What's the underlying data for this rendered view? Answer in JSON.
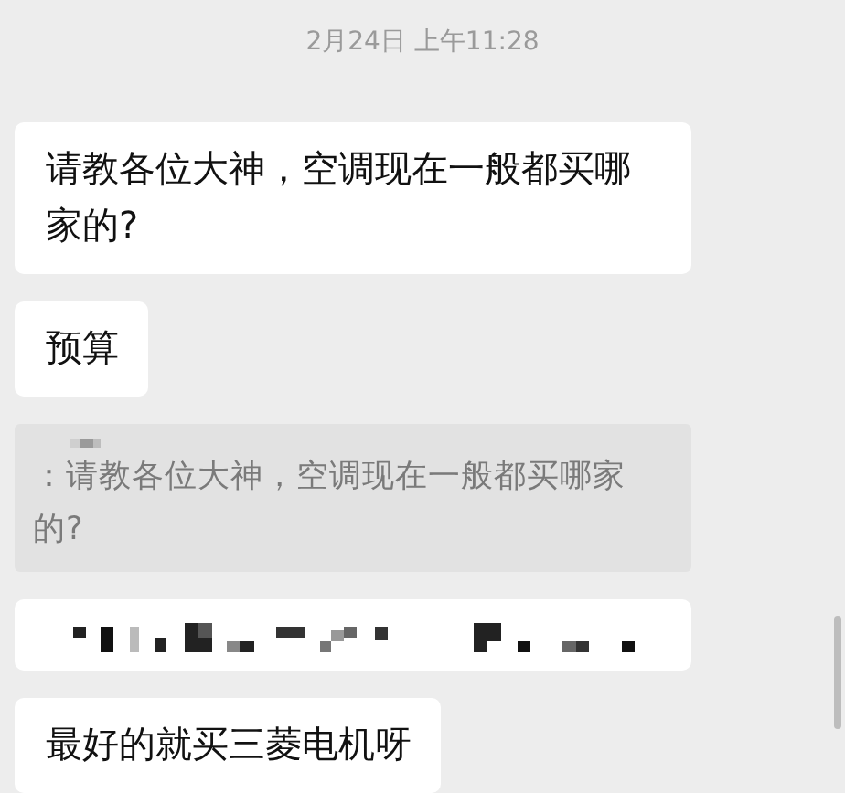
{
  "timestamp": "2月24日 上午11:28",
  "messages": [
    {
      "kind": "text",
      "text": "请教各位大神，空调现在一般都买哪家的?"
    },
    {
      "kind": "text",
      "text": "预算"
    },
    {
      "kind": "quote",
      "text": "：请教各位大神，空调现在一般都买哪家的?"
    },
    {
      "kind": "redacted"
    },
    {
      "kind": "text",
      "text": "最好的就买三菱电机呀"
    }
  ]
}
